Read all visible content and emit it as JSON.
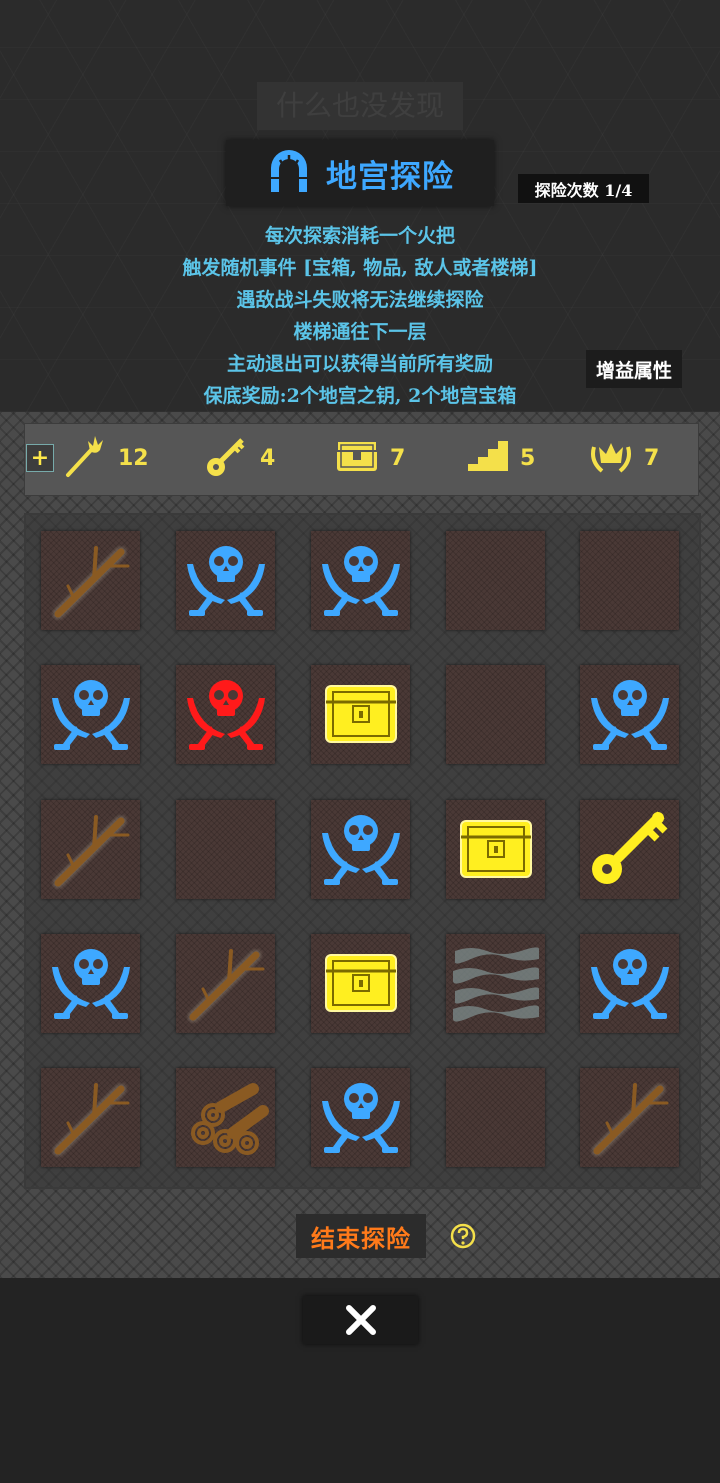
{
  "ghost_banner": "什么也没发现",
  "title": "地宫探险",
  "explore_count": "探险次数 1/4",
  "rules": [
    "每次探索消耗一个火把",
    "触发随机事件 [宝箱, 物品, 敌人或者楼梯]",
    "遇敌战斗失败将无法继续探险",
    "楼梯通往下一层",
    "主动退出可以获得当前所有奖励",
    "保底奖励:2个地宫之钥, 2个地宫宝箱"
  ],
  "buff_button": "增益属性",
  "resources": {
    "plus": "+",
    "torch": "12",
    "key": "4",
    "chest": "7",
    "stairs": "5",
    "crown": "7"
  },
  "grid": [
    [
      "branch",
      "skull-blue",
      "skull-blue",
      "empty",
      "empty"
    ],
    [
      "skull-blue",
      "skull-red",
      "chest",
      "empty",
      "skull-blue"
    ],
    [
      "branch",
      "empty",
      "skull-blue",
      "chest",
      "key"
    ],
    [
      "skull-blue",
      "branch",
      "chest",
      "water",
      "skull-blue"
    ],
    [
      "branch",
      "logs",
      "skull-blue",
      "empty",
      "branch"
    ]
  ],
  "end_button": "结束探险",
  "colors": {
    "accent_blue": "#3ea8ff",
    "rule_text": "#5bc4e8",
    "gold": "#f4e04a",
    "enemy_red": "#ff1a1a",
    "end_orange": "#ff7a1a"
  }
}
